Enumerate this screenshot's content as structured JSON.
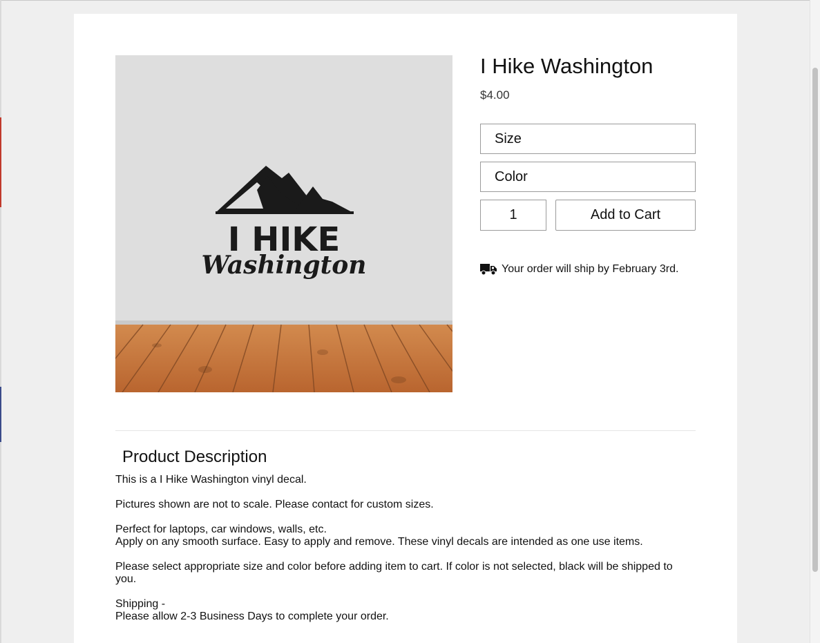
{
  "product": {
    "title": "I Hike Washington",
    "price": "$4.00",
    "image_alt_text_lines": [
      "I HIKE",
      "Washington"
    ]
  },
  "options": {
    "size_label": "Size",
    "color_label": "Color"
  },
  "purchase": {
    "quantity": "1",
    "add_to_cart_label": "Add to Cart"
  },
  "shipping": {
    "icon": "truck-icon",
    "message": "Your order will ship by February 3rd."
  },
  "description": {
    "heading": "Product Description",
    "paragraphs": [
      [
        "This is a I Hike Washington vinyl decal."
      ],
      [
        "Pictures shown are not to scale. Please contact for custom sizes."
      ],
      [
        "Perfect for laptops, car windows, walls, etc.",
        "Apply on any smooth surface. Easy to apply and remove. These vinyl decals are intended as one use items."
      ],
      [
        "Please select appropriate size and color before adding item to cart. If color is not selected, black will be shipped to you."
      ],
      [
        "Shipping -",
        "Please allow 2-3 Business Days to complete your order."
      ]
    ]
  },
  "colors": {
    "wall": "#dedede",
    "floor": "#c8783f",
    "decal": "#1a1a1a",
    "border": "#9a9a9a"
  }
}
